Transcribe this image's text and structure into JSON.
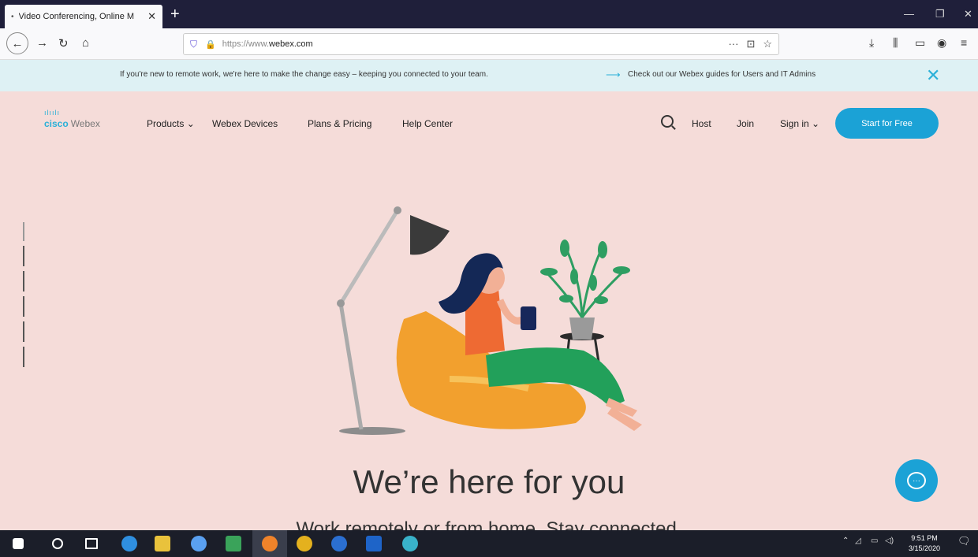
{
  "browser": {
    "tab_title": "Video Conferencing, Online M",
    "url_prefix": "https://www.",
    "url_host": "webex.com",
    "url_menu": "···"
  },
  "notification": {
    "message": "If you're new to remote work, we're here to make the change easy – keeping you connected to your team.",
    "link": "Check out our Webex guides for Users and IT Admins"
  },
  "site": {
    "logo_cisco": "cisco",
    "logo_webex": "Webex",
    "nav": [
      "Products ⌄",
      "Webex Devices",
      "Plans & Pricing",
      "Help Center"
    ],
    "host": "Host",
    "join": "Join",
    "sign_in": "Sign in ⌄",
    "cta": "Start for Free"
  },
  "hero": {
    "headline": "We’re here for you",
    "subline": "Work remotely or from home. Stay connected."
  },
  "taskbar": {
    "time": "9:51 PM",
    "date": "3/15/2020"
  },
  "colors": {
    "page_bg": "#f5dcd9",
    "accent": "#1ba2d6",
    "notif_bg": "#def1f4"
  }
}
